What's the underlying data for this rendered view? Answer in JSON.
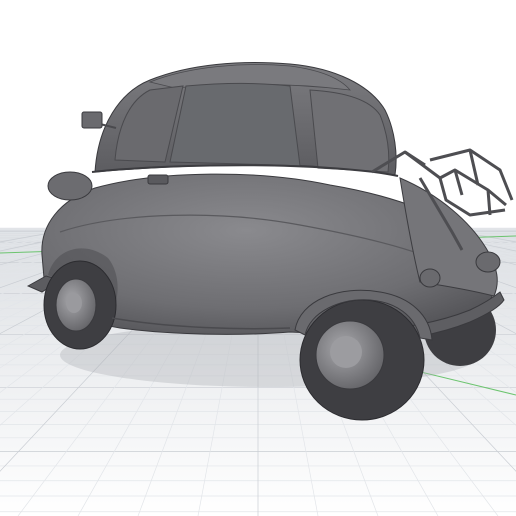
{
  "viewport": {
    "background": "#ffffff",
    "floor_top": "#dcdfe3",
    "floor_bottom": "#ffffff",
    "grid_minor": "#e2e5e9",
    "grid_major": "#c9cdd3",
    "axis_x_color": "#4caf50",
    "axis_y_color": "#4caf50"
  },
  "model": {
    "body_color": "#6e6e72",
    "body_dark": "#4a4a4e",
    "body_light": "#8a8a8e",
    "tire_color": "#3e3e42",
    "hub_color": "#8c8c90",
    "rack_color": "#55555a"
  }
}
